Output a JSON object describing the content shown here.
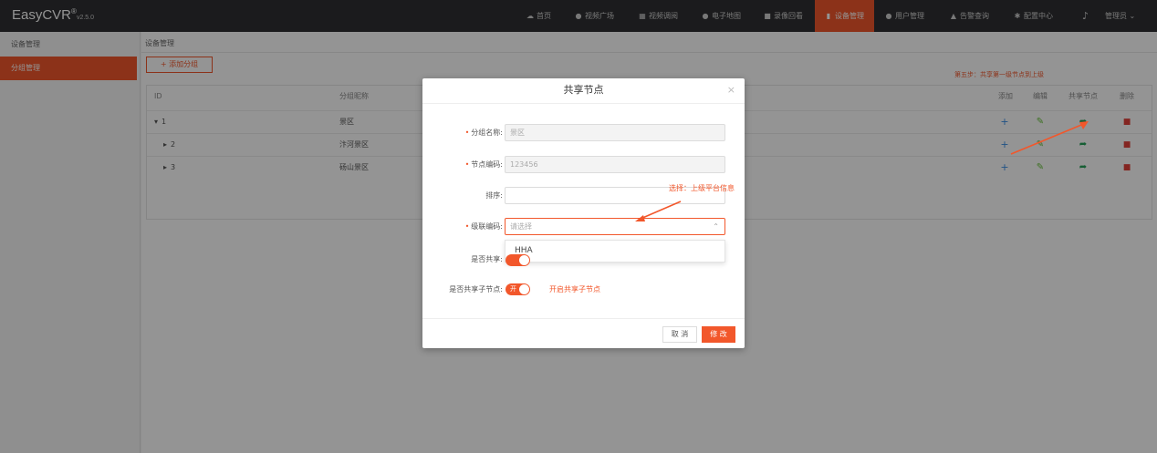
{
  "app": {
    "name": "EasyCVR",
    "reg": "®",
    "version": "v2.5.0"
  },
  "nav": {
    "items": [
      {
        "label": "首页",
        "icon": "cloud-icon"
      },
      {
        "label": "视频广场",
        "icon": "play-circle-icon"
      },
      {
        "label": "视频调阅",
        "icon": "grid-icon"
      },
      {
        "label": "电子地图",
        "icon": "map-pin-icon"
      },
      {
        "label": "录像回看",
        "icon": "video-icon"
      },
      {
        "label": "设备管理",
        "icon": "bar-chart-icon"
      },
      {
        "label": "用户管理",
        "icon": "user-icon"
      },
      {
        "label": "告警查询",
        "icon": "alarm-icon"
      },
      {
        "label": "配置中心",
        "icon": "gear-icon"
      }
    ],
    "active": "设备管理",
    "bell_icon": "bell-icon",
    "user_label": "管理员 ⌄"
  },
  "sidebar": {
    "title": "设备管理",
    "item": "分组管理"
  },
  "main": {
    "breadcrumb": "设备管理",
    "add_group": "+ 添加分组",
    "hint": "第五步：共享第一级节点到上级",
    "table": {
      "headers": {
        "id": "ID",
        "name": "分组昵称",
        "add": "添加",
        "edit": "编辑",
        "share": "共享节点",
        "delete": "删除"
      },
      "rows": [
        {
          "arrow": "▾",
          "id": "1",
          "name": "景区"
        },
        {
          "arrow": "▸",
          "id": "2",
          "name": "汴河景区"
        },
        {
          "arrow": "▸",
          "id": "3",
          "name": "砀山景区"
        }
      ]
    }
  },
  "modal": {
    "title": "共享节点",
    "close": "×",
    "fields": {
      "group_name_label": "分组名称:",
      "group_name_value": "景区",
      "node_code_label": "节点编码:",
      "node_code_value": "123456",
      "sort_label": "排序:",
      "cascade_label": "级联编码:",
      "cascade_placeholder": "请选择",
      "shared_label": "是否共享:",
      "share_children_label": "是否共享子节点:"
    },
    "dropdown_option": "HHA",
    "switch_on": "开",
    "share_children_hint": "开启共享子节点",
    "select_hint": "选择：上级平台信息",
    "cancel": "取 消",
    "submit": "修 改"
  },
  "colors": {
    "accent": "#f2572b",
    "topbar": "#2f3033"
  }
}
